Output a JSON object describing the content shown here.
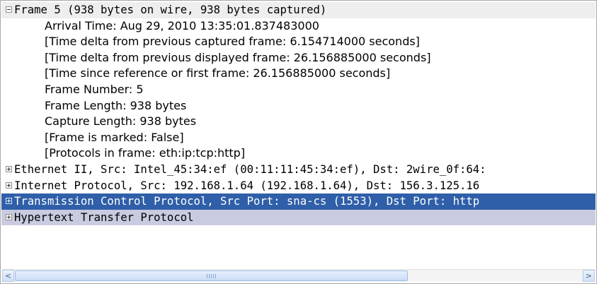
{
  "tree": {
    "frame_header": "Frame 5 (938 bytes on wire, 938 bytes captured)",
    "frame_details": [
      "Arrival Time: Aug 29, 2010 13:35:01.837483000",
      "[Time delta from previous captured frame: 6.154714000 seconds]",
      "[Time delta from previous displayed frame: 26.156885000 seconds]",
      "[Time since reference or first frame: 26.156885000 seconds]",
      "Frame Number: 5",
      "Frame Length: 938 bytes",
      "Capture Length: 938 bytes",
      "[Frame is marked: False]",
      "[Protocols in frame: eth:ip:tcp:http]"
    ],
    "protocols": [
      "Ethernet II, Src: Intel_45:34:ef (00:11:11:45:34:ef), Dst: 2wire_0f:64:",
      "Internet Protocol, Src: 192.168.1.64 (192.168.1.64), Dst: 156.3.125.16",
      "Transmission Control Protocol, Src Port: sna-cs (1553), Dst Port: http",
      "Hypertext Transfer Protocol"
    ]
  },
  "selected_protocol": "Transmission Control Protocol",
  "scrollbar": {
    "left_arrow": "<",
    "right_arrow": ">",
    "position": 0.0
  },
  "colors": {
    "selection": "#2f5fa8",
    "hover_row": "#c9cbe0"
  }
}
